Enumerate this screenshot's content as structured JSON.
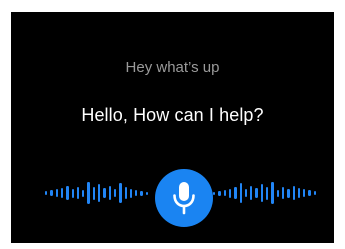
{
  "assistant": {
    "prompt_text": "Hey what’s up",
    "greeting_text": "Hello, How can I help?"
  },
  "voice_input": {
    "mic_icon": "microphone-icon",
    "state": "listening"
  },
  "colors": {
    "background": "#000000",
    "accent": "#1a84f2",
    "prompt_text": "#9a9a9a",
    "greeting_text": "#ffffff"
  }
}
